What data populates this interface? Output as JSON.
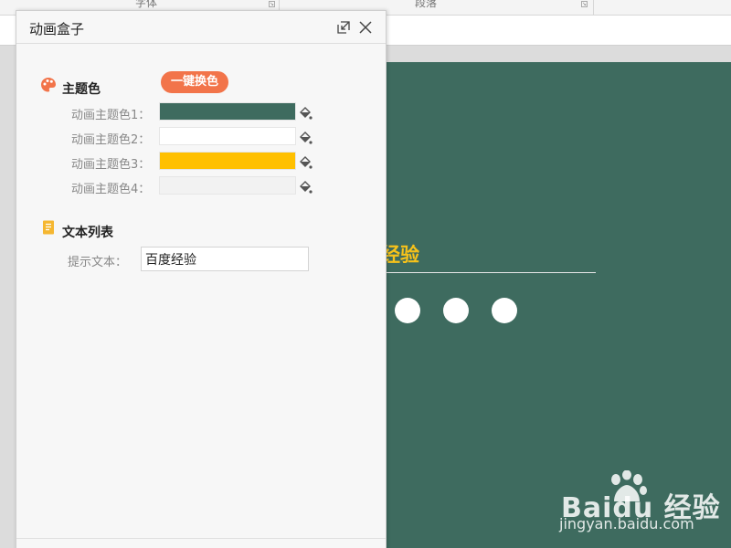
{
  "ribbon": {
    "groups": [
      {
        "label": "字体"
      },
      {
        "label": "段落"
      }
    ]
  },
  "slide": {
    "title": "度经验",
    "dots": 3,
    "colors": {
      "background": "#3e6b5f",
      "title": "#f7c21a"
    }
  },
  "watermark": {
    "brand": "Baidu 经验",
    "url": "jingyan.baidu.com"
  },
  "panel": {
    "title": "动画盒子",
    "header_icons": [
      "restore-icon",
      "close-icon"
    ],
    "theme_section": {
      "title": "主题色",
      "icon": "palette-icon",
      "one_click_button": "一键换色",
      "colors": [
        {
          "label": "动画主题色1：",
          "value": "#3e6b5f"
        },
        {
          "label": "动画主题色2：",
          "value": "#ffffff"
        },
        {
          "label": "动画主题色3：",
          "value": "#ffc000"
        },
        {
          "label": "动画主题色4：",
          "value": "#f2f2f2"
        }
      ]
    },
    "text_section": {
      "title": "文本列表",
      "icon": "document-icon",
      "prompt_label": "提示文本：",
      "prompt_value": "百度经验"
    }
  },
  "accent_color": "#f2744a"
}
